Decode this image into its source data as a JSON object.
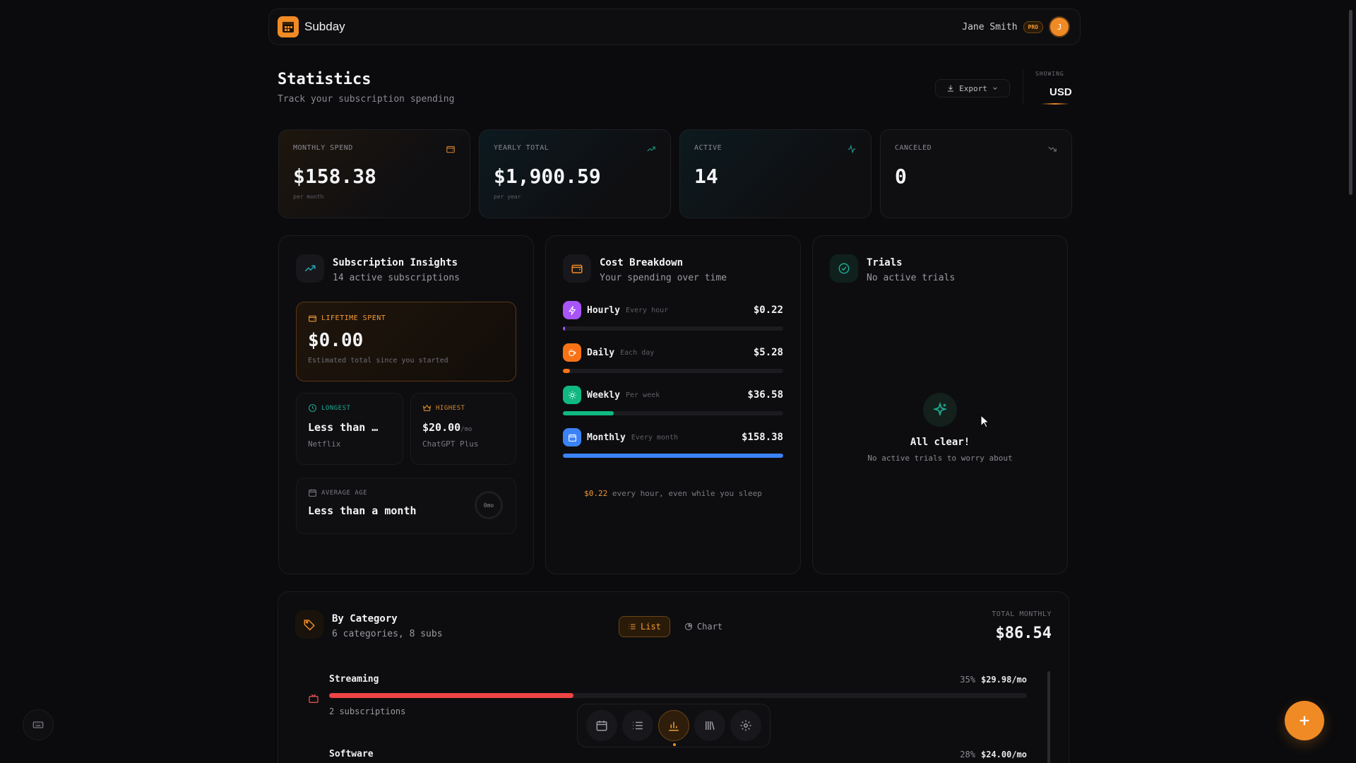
{
  "header": {
    "app_name": "Subday",
    "user_name": "Jane Smith",
    "badge": "PRO",
    "avatar_initial": "J"
  },
  "page": {
    "title": "Statistics",
    "subtitle": "Track your subscription spending",
    "export_label": "Export",
    "showing_label": "SHOWING",
    "currency": "USD"
  },
  "stats": [
    {
      "label": "MONTHLY SPEND",
      "value": "$158.38",
      "sub": "per month",
      "icon": "wallet-icon"
    },
    {
      "label": "YEARLY TOTAL",
      "value": "$1,900.59",
      "sub": "per year",
      "icon": "trending-up-icon"
    },
    {
      "label": "ACTIVE",
      "value": "14",
      "sub": "",
      "icon": "activity-icon"
    },
    {
      "label": "CANCELED",
      "value": "0",
      "sub": "",
      "icon": "trending-down-icon"
    }
  ],
  "insights": {
    "title": "Subscription Insights",
    "subtitle": "14 active subscriptions",
    "lifetime_label": "LIFETIME SPENT",
    "lifetime_value": "$0.00",
    "lifetime_sub": "Estimated total since you started",
    "longest_label": "LONGEST",
    "longest_value": "Less than …",
    "longest_sub": "Netflix",
    "highest_label": "HIGHEST",
    "highest_value": "$20.00",
    "highest_unit": "/mo",
    "highest_sub": "ChatGPT Plus",
    "avg_label": "AVERAGE AGE",
    "avg_value": "Less than a month",
    "avg_ring": "0mo"
  },
  "cost": {
    "title": "Cost Breakdown",
    "subtitle": "Your spending over time",
    "rows": [
      {
        "name": "Hourly",
        "hint": "Every hour",
        "value": "$0.22",
        "fill": 0.002,
        "color": "#a855f7"
      },
      {
        "name": "Daily",
        "hint": "Each day",
        "value": "$5.28",
        "fill": 0.033,
        "color": "#f97316"
      },
      {
        "name": "Weekly",
        "hint": "Per week",
        "value": "$36.58",
        "fill": 0.231,
        "color": "#10b981"
      },
      {
        "name": "Monthly",
        "hint": "Every month",
        "value": "$158.38",
        "fill": 1.0,
        "color": "#3b82f6"
      }
    ],
    "footer_amount": "$0.22",
    "footer_text": "every hour, even while you sleep"
  },
  "trials": {
    "title": "Trials",
    "subtitle": "No active trials",
    "empty_title": "All clear!",
    "empty_sub": "No active trials to worry about"
  },
  "category": {
    "title": "By Category",
    "subtitle": "6 categories, 8 subs",
    "toggle_list": "List",
    "toggle_chart": "Chart",
    "total_label": "TOTAL MONTHLY",
    "total_value": "$86.54",
    "rows": [
      {
        "name": "Streaming",
        "percent": "35%",
        "amount": "$29.98/mo",
        "count": "2 subscriptions",
        "fill": 0.35
      },
      {
        "name": "Software",
        "percent": "28%",
        "amount": "$24.00/mo",
        "count": "",
        "fill": 0.28
      }
    ]
  },
  "colors": {
    "accent": "#f08a24",
    "bg": "#0b0b0d"
  }
}
